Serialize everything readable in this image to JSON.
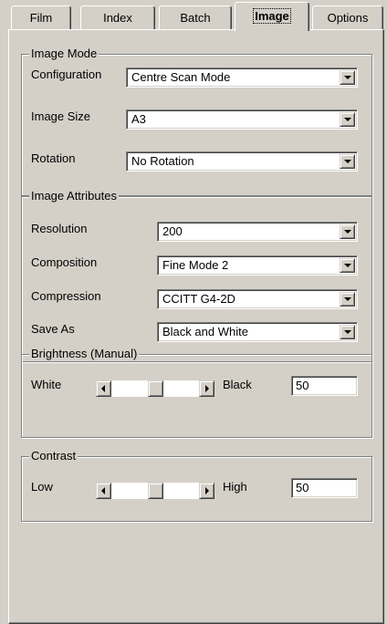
{
  "tabs": [
    {
      "label": "Film",
      "active": false
    },
    {
      "label": "Index",
      "active": false
    },
    {
      "label": "Batch",
      "active": false
    },
    {
      "label": "Image",
      "active": true
    },
    {
      "label": "Options",
      "active": false
    }
  ],
  "image_mode": {
    "title": "Image Mode",
    "configuration": {
      "label": "Configuration",
      "value": "Centre Scan Mode"
    },
    "image_size": {
      "label": "Image Size",
      "value": "A3"
    },
    "rotation": {
      "label": "Rotation",
      "value": "No Rotation"
    }
  },
  "image_attributes": {
    "title": "Image Attributes",
    "resolution": {
      "label": "Resolution",
      "value": "200"
    },
    "composition": {
      "label": "Composition",
      "value": "Fine Mode 2"
    },
    "compression": {
      "label": "Compression",
      "value": "CCITT G4-2D"
    },
    "save_as": {
      "label": "Save As",
      "value": "Black and White"
    }
  },
  "brightness": {
    "title": "Brightness (Manual)",
    "low_label": "White",
    "high_label": "Black",
    "value": "50",
    "level": 0.5
  },
  "contrast": {
    "title": "Contrast",
    "low_label": "Low",
    "high_label": "High",
    "value": "50",
    "level": 0.5
  }
}
